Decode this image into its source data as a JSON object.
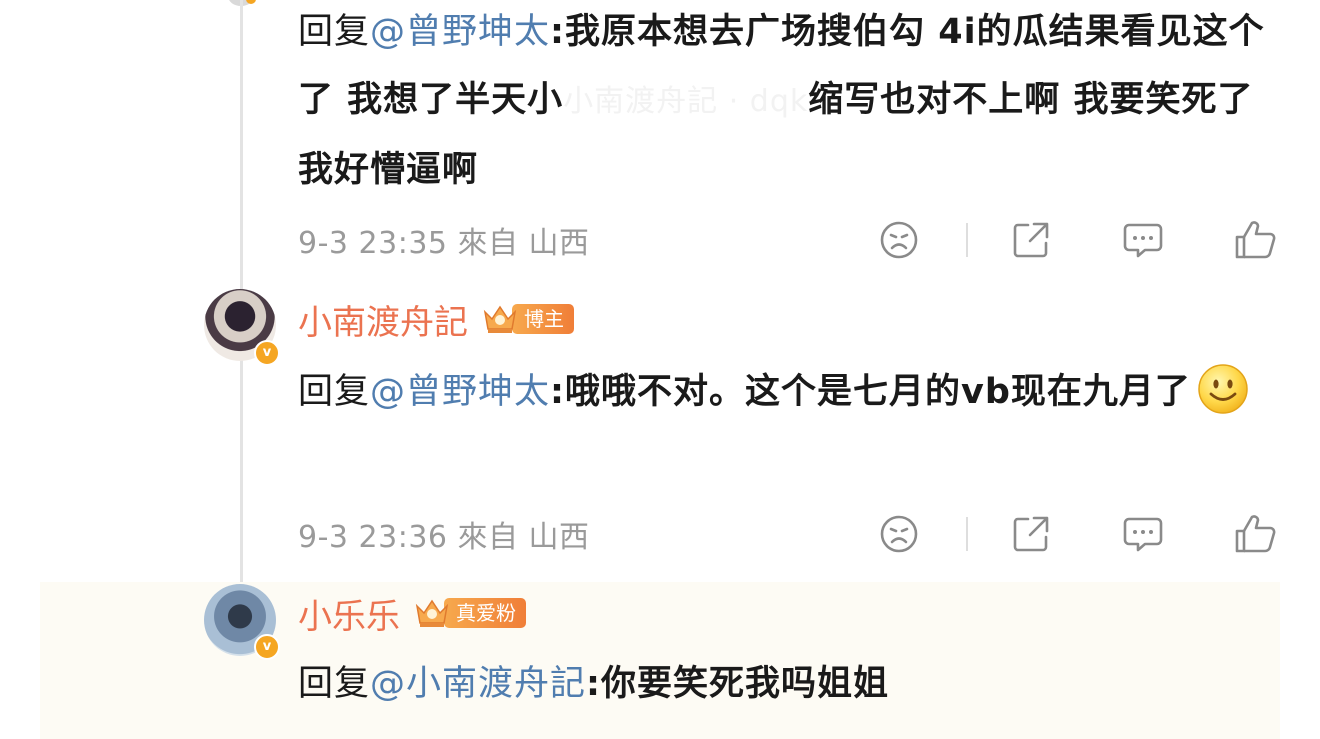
{
  "comments": [
    {
      "reply_prefix": "回复",
      "mention": "@曾野坤太",
      "text": ":我原本想去广场搜伯勾 4i的瓜结果看见这个了 我想了半天小",
      "text_tail": "缩写也对不上啊 我要笑死了我好懵逼啊",
      "watermark": "小南渡舟記 · dqk",
      "time": "9-3 23:35 來自 山西"
    },
    {
      "username": "小南渡舟記",
      "tag": "博主",
      "verified_mark": "v",
      "reply_prefix": "回复",
      "mention": "@曾野坤太",
      "text": ":哦哦不对。这个是七月的vb现在九月了",
      "emoji": "smile-emoji",
      "time": "9-3 23:36 來自 山西"
    },
    {
      "username": "小乐乐",
      "tag": "真爱粉",
      "verified_mark": "v",
      "reply_prefix": "回复",
      "mention": "@小南渡舟記",
      "text": ":你要笑死我吗姐姐"
    }
  ],
  "icons": [
    "dislike-icon",
    "share-icon",
    "comment-icon",
    "like-icon",
    "crown-icon"
  ],
  "colors": {
    "username": "#eb7350",
    "mention": "#507daf",
    "meta": "#9a9a9a",
    "tag": "#f07e38",
    "highlight": "#fdfbf4"
  }
}
